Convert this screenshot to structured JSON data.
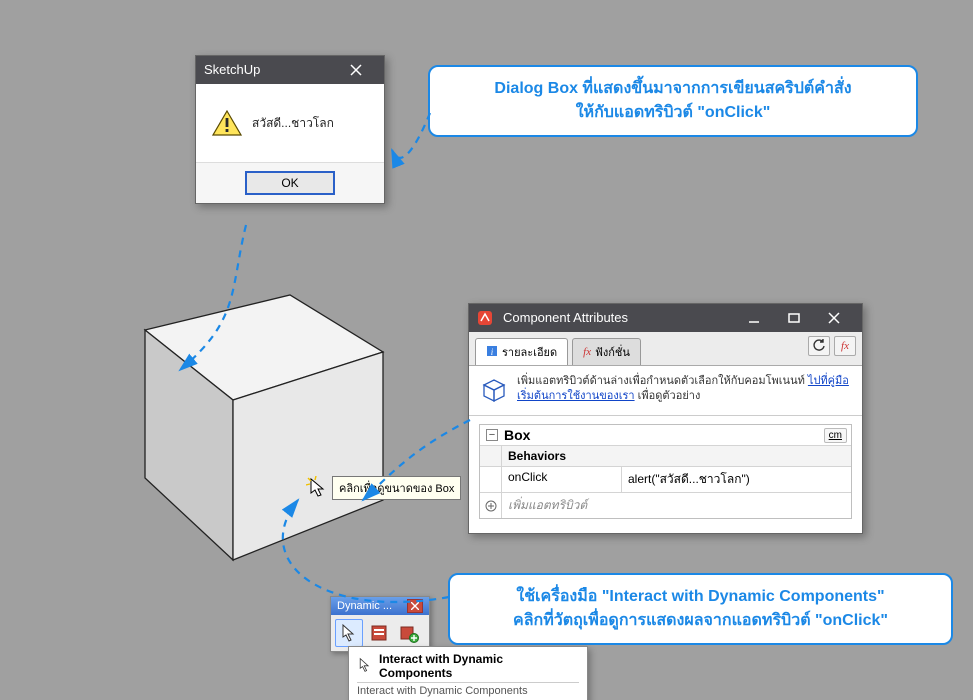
{
  "msgbox": {
    "title": "SketchUp",
    "text": "สวัสดี...ชาวโลก",
    "ok": "OK"
  },
  "callout_top": "Dialog Box ที่แสดงขึ้นมาจากการเขียนสคริปต์คำสั่ง\nให้กับแอดทริบิวต์ \"onClick\"",
  "callout_bottom": "ใช้เครื่องมือ \"Interact with Dynamic Components\"\nคลิกที่วัตถุเพื่อดูการแสดงผลจากแอดทริบิวต์ \"onClick\"",
  "cursor_tip": "คลิกเพื่อดูขนาดของ Box",
  "component_attrs": {
    "title": "Component Attributes",
    "tab_detail": "รายละเอียด",
    "tab_functions": "ฟังก์ชั่น",
    "info_prefix": "เพิ่มแอตทริบิวต์ด้านล่างเพื่อกำหนดตัวเลือกให้กับคอมโพเนนท์ ",
    "info_link": "ไปที่คู่มือเริ่มต้นการใช้งานของเรา",
    "info_suffix": " เพื่อดูตัวอย่าง",
    "unit": "cm",
    "component_name": "Box",
    "section_behaviors": "Behaviors",
    "attr_name": "onClick",
    "attr_value": "alert(\"สวัสดี...ชาวโลก\")",
    "add_attr": "เพิ่มแอตทริบิวต์"
  },
  "dyn_toolbar": {
    "title": "Dynamic ...",
    "tooltip_title": "Interact with Dynamic Components",
    "tooltip_desc": "Interact with Dynamic Components"
  }
}
